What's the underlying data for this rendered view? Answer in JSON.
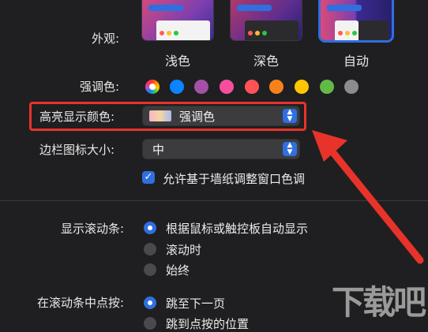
{
  "appearance": {
    "label": "外观:",
    "options": [
      {
        "label": "浅色",
        "selected": false
      },
      {
        "label": "深色",
        "selected": false
      },
      {
        "label": "自动",
        "selected": true
      }
    ]
  },
  "accent": {
    "label": "强调色:",
    "colors": [
      "multicolor",
      "#0a84ff",
      "#a550a7",
      "#f74f9e",
      "#ff5257",
      "#f7821b",
      "#ffc600",
      "#62ba46",
      "#8c8c8c"
    ]
  },
  "highlight": {
    "label": "高亮显示颜色:",
    "value": "强调色"
  },
  "sidebar_icon": {
    "label": "边栏图标大小:",
    "value": "中"
  },
  "wallpaper_tint": {
    "label": "允许基于墙纸调整窗口色调",
    "checked": true
  },
  "scrollbars": {
    "label": "显示滚动条:",
    "options": [
      {
        "label": "根据鼠标或触控板自动显示",
        "selected": true
      },
      {
        "label": "滚动时",
        "selected": false
      },
      {
        "label": "始终",
        "selected": false
      }
    ]
  },
  "scroll_click": {
    "label": "在滚动条中点按:",
    "options": [
      {
        "label": "跳至下一页",
        "selected": true
      },
      {
        "label": "跳到点按的位置",
        "selected": false
      }
    ]
  },
  "watermark": "下载吧",
  "colors": {
    "accent_blue": "#2f6fe0",
    "annotation_red": "#e8332a"
  }
}
